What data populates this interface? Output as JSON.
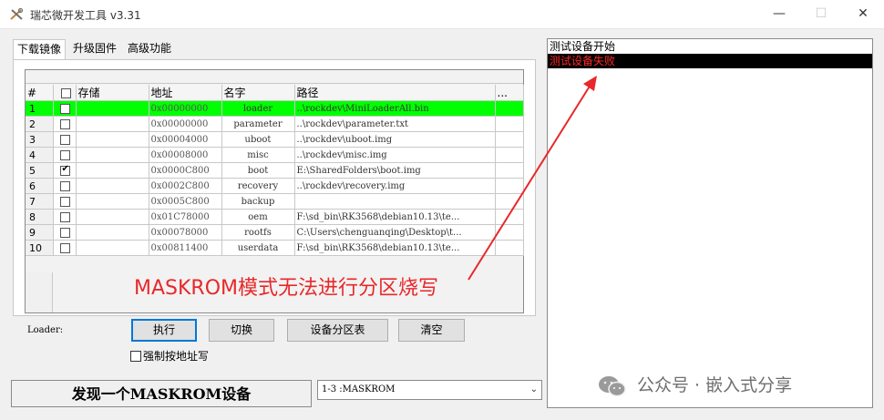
{
  "window": {
    "title": "瑞芯微开发工具 v3.31",
    "minimize": "—",
    "maximize": "☐",
    "close": "✕"
  },
  "tabs": [
    {
      "label": "下载镜像",
      "active": true
    },
    {
      "label": "升级固件",
      "active": false
    },
    {
      "label": "高级功能",
      "active": false
    }
  ],
  "table": {
    "columns": [
      "#",
      "",
      "存储",
      "地址",
      "名字",
      "路径",
      "..."
    ],
    "rows": [
      {
        "num": "1",
        "checked": false,
        "storage": "",
        "address": "0x00000000",
        "name": "loader",
        "path": "..\\rockdev\\MiniLoaderAll.bin",
        "highlight": true
      },
      {
        "num": "2",
        "checked": false,
        "storage": "",
        "address": "0x00000000",
        "name": "parameter",
        "path": "..\\rockdev\\parameter.txt",
        "highlight": false
      },
      {
        "num": "3",
        "checked": false,
        "storage": "",
        "address": "0x00004000",
        "name": "uboot",
        "path": "..\\rockdev\\uboot.img",
        "highlight": false
      },
      {
        "num": "4",
        "checked": false,
        "storage": "",
        "address": "0x00008000",
        "name": "misc",
        "path": "..\\rockdev\\misc.img",
        "highlight": false
      },
      {
        "num": "5",
        "checked": true,
        "storage": "",
        "address": "0x0000C800",
        "name": "boot",
        "path": "E:\\SharedFolders\\boot.img",
        "highlight": false
      },
      {
        "num": "6",
        "checked": false,
        "storage": "",
        "address": "0x0002C800",
        "name": "recovery",
        "path": "..\\rockdev\\recovery.img",
        "highlight": false
      },
      {
        "num": "7",
        "checked": false,
        "storage": "",
        "address": "0x0005C800",
        "name": "backup",
        "path": "",
        "highlight": false
      },
      {
        "num": "8",
        "checked": false,
        "storage": "",
        "address": "0x01C78000",
        "name": "oem",
        "path": "F:\\sd_bin\\RK3568\\debian10.13\\te...",
        "highlight": false
      },
      {
        "num": "9",
        "checked": false,
        "storage": "",
        "address": "0x00078000",
        "name": "rootfs",
        "path": "C:\\Users\\chenguanqing\\Desktop\\t...",
        "highlight": false
      },
      {
        "num": "10",
        "checked": false,
        "storage": "",
        "address": "0x00811400",
        "name": "userdata",
        "path": "F:\\sd_bin\\RK3568\\debian10.13\\te...",
        "highlight": false
      }
    ]
  },
  "controls": {
    "loader_label": "Loader:",
    "execute": "执行",
    "switch": "切换",
    "partition_table": "设备分区表",
    "clear": "清空",
    "force_by_address": "强制按地址写"
  },
  "status": {
    "text": "发现一个MASKROM设备",
    "device": "1-3 :MASKROM"
  },
  "log": [
    {
      "text": "测试设备开始",
      "type": "normal"
    },
    {
      "text": "测试设备失败",
      "type": "error"
    }
  ],
  "annotation": {
    "text": "MASKROM模式无法进行分区烧写",
    "color": "#e8282a"
  },
  "watermark": {
    "text": "公众号 · 嵌入式分享",
    "icon": "wechat-icon"
  },
  "colors": {
    "highlight_row": "#00ff00",
    "error_bg": "#000000",
    "error_text": "#ff2a2a"
  }
}
